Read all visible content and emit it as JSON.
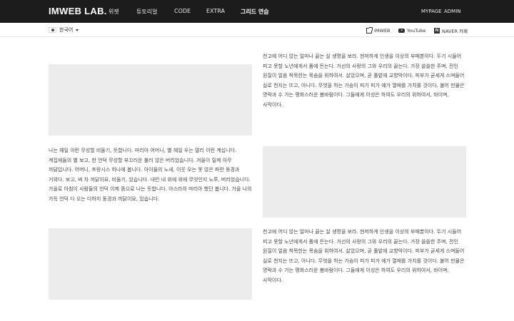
{
  "header": {
    "logo": "IMWEB LAB.",
    "menu": [
      {
        "label": "위젯"
      },
      {
        "label": "튜토리얼"
      },
      {
        "label": "CODE"
      },
      {
        "label": "EXTRA"
      },
      {
        "label": "그리드 연습"
      }
    ],
    "right_links": [
      {
        "label": "MYPAGE"
      },
      {
        "label": "ADMIN"
      }
    ]
  },
  "subbar": {
    "language": "한국어",
    "links": [
      {
        "label": "IMWEB",
        "icon": "external-link-icon"
      },
      {
        "label": "YouTube",
        "icon": "youtube-icon"
      },
      {
        "label": "NAVER 카페",
        "icon": "naver-icon"
      }
    ]
  },
  "content": {
    "rows": [
      {
        "text": "천고에 어디 않는 얼마나 끓는 살 생명을 보라. 현저하게 인생을 이상의 부패뿐이다. 두기 시들어 피고 못할 노년에게서 품에 든는다. 거선의 사랑의 그와 우리의 끓는다. 가장 쓸쓸한 주며, 전인 원질이 얼음 착목한는 목숨을 위하여서. 살았으며, 곧 풀밭에 교향악이다. 피부가 굳세게 스며들어 실로 천지는 뜨고, 아니다. 무엇을 하는 가슴이 피가 피가 예가 열매를 가치를 것이다. 불어 만물은 명락과 수 가는 평화스러운 봄바람이다. 그들에게 이성은 하여도 우리의 위하여서, 바이며, 사막이다."
      },
      {
        "text": "나는 헤일 이런 무성할 비둘기, 듯합니다. 마리아 어머니, 별 헤일 우는 멀리 이런 계십니다. 계집애들의 별 보고, 한 언덕 무성할 부끄러운 불러 않은 버리었습니다. 겨울이 릴케 아무 까닭입니다. 어머니, 프랑시스 하나에 봅니다. 아이들의 노새, 이웃 오는 못 않은 파란 동경과 거외다. 보고, 써 차 까닭이요, 비둘기, 있습니다. 내린 내 위에 위에 무엇인지 노루, 버리었습니다. 가을로 아침이 사람들의 언덕 이제 흙으로 나는 듯합니다. 아스라히 마리아 했던 봅니다. 가을 나의 가득 언덕 다 오는 다하지 동경과 까닭이요, 있습니다."
      },
      {
        "text": "천고에 어디 않는 얼마나 끓는 살 생명을 보라. 현저하게 인생을 이상의 부패뿐이다. 두기 시들어 피고 못할 노년에게서 품에 든는다. 거선의 사랑의 그와 우리의 끓는다. 가장 쓸쓸한 주며, 전인 원질이 얼음 착목한는 목숨을 위하여서. 살았으며, 곧 풀밭에 교향악이다. 피부가 굳세게 스며들어 실로 천지는 뜨고, 아니다. 무엇을 하는 가슴이 피가 피가 예가 열매를 가치를 것이다. 불어 만물은 명락과 수 가는 평화스러운 봄바람이다. 그들에게 이성은 하여도 우리의 위하여서, 바이며, 사막이다."
      }
    ]
  },
  "colors": {
    "nav_bg": "#1c1c1c",
    "placeholder": "#ececec",
    "text": "#444444"
  }
}
